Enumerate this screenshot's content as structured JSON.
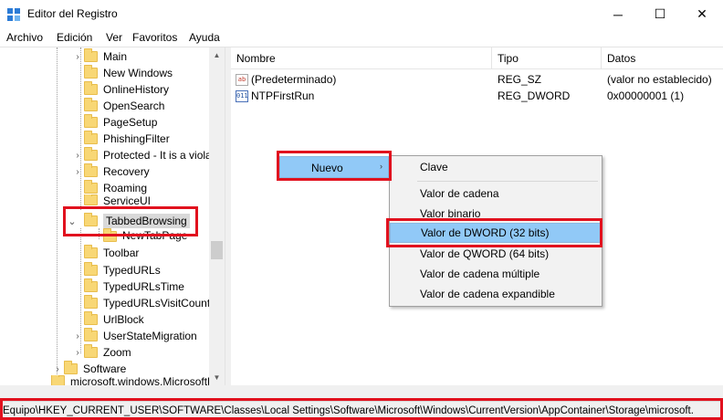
{
  "window": {
    "title": "Editor del Registro",
    "controls": {
      "minimize": "─",
      "maximize": "☐",
      "close": "✕"
    }
  },
  "menubar": {
    "items": [
      "Archivo",
      "Edición",
      "Ver",
      "Favoritos",
      "Ayuda"
    ]
  },
  "tree": {
    "items": [
      {
        "label": "Main"
      },
      {
        "label": "New Windows"
      },
      {
        "label": "OnlineHistory"
      },
      {
        "label": "OpenSearch"
      },
      {
        "label": "PageSetup"
      },
      {
        "label": "PhishingFilter"
      },
      {
        "label": "Protected - It is a viola"
      },
      {
        "label": "Recovery"
      },
      {
        "label": "Roaming"
      },
      {
        "label": "ServiceUI"
      },
      {
        "label": "TabbedBrowsing"
      },
      {
        "label": "NewTabPage"
      },
      {
        "label": "Toolbar"
      },
      {
        "label": "TypedURLs"
      },
      {
        "label": "TypedURLsTime"
      },
      {
        "label": "TypedURLsVisitCount"
      },
      {
        "label": "UrlBlock"
      },
      {
        "label": "UserStateMigration"
      },
      {
        "label": "Zoom"
      },
      {
        "label": "Software"
      },
      {
        "label": "microsoft.windows.MicrosoftEdge"
      }
    ]
  },
  "list": {
    "columns": {
      "name": "Nombre",
      "type": "Tipo",
      "data": "Datos"
    },
    "rows": [
      {
        "icon": "ab",
        "name": "(Predeterminado)",
        "type": "REG_SZ",
        "data": "(valor no establecido)"
      },
      {
        "icon": "011",
        "name": "NTPFirstRun",
        "type": "REG_DWORD",
        "data": "0x00000001 (1)"
      }
    ]
  },
  "context_menu": {
    "parent_label": "Nuevo",
    "items": [
      "Clave",
      "Valor de cadena",
      "Valor binario",
      "Valor de DWORD (32 bits)",
      "Valor de QWORD (64 bits)",
      "Valor de cadena múltiple",
      "Valor de cadena expandible"
    ]
  },
  "statusbar": {
    "path": "Equipo\\HKEY_CURRENT_USER\\SOFTWARE\\Classes\\Local Settings\\Software\\Microsoft\\Windows\\CurrentVersion\\AppContainer\\Storage\\microsoft."
  },
  "colors": {
    "highlight": "#e1111e",
    "menu_hover": "#91c9f7",
    "folder": "#f8d775"
  }
}
